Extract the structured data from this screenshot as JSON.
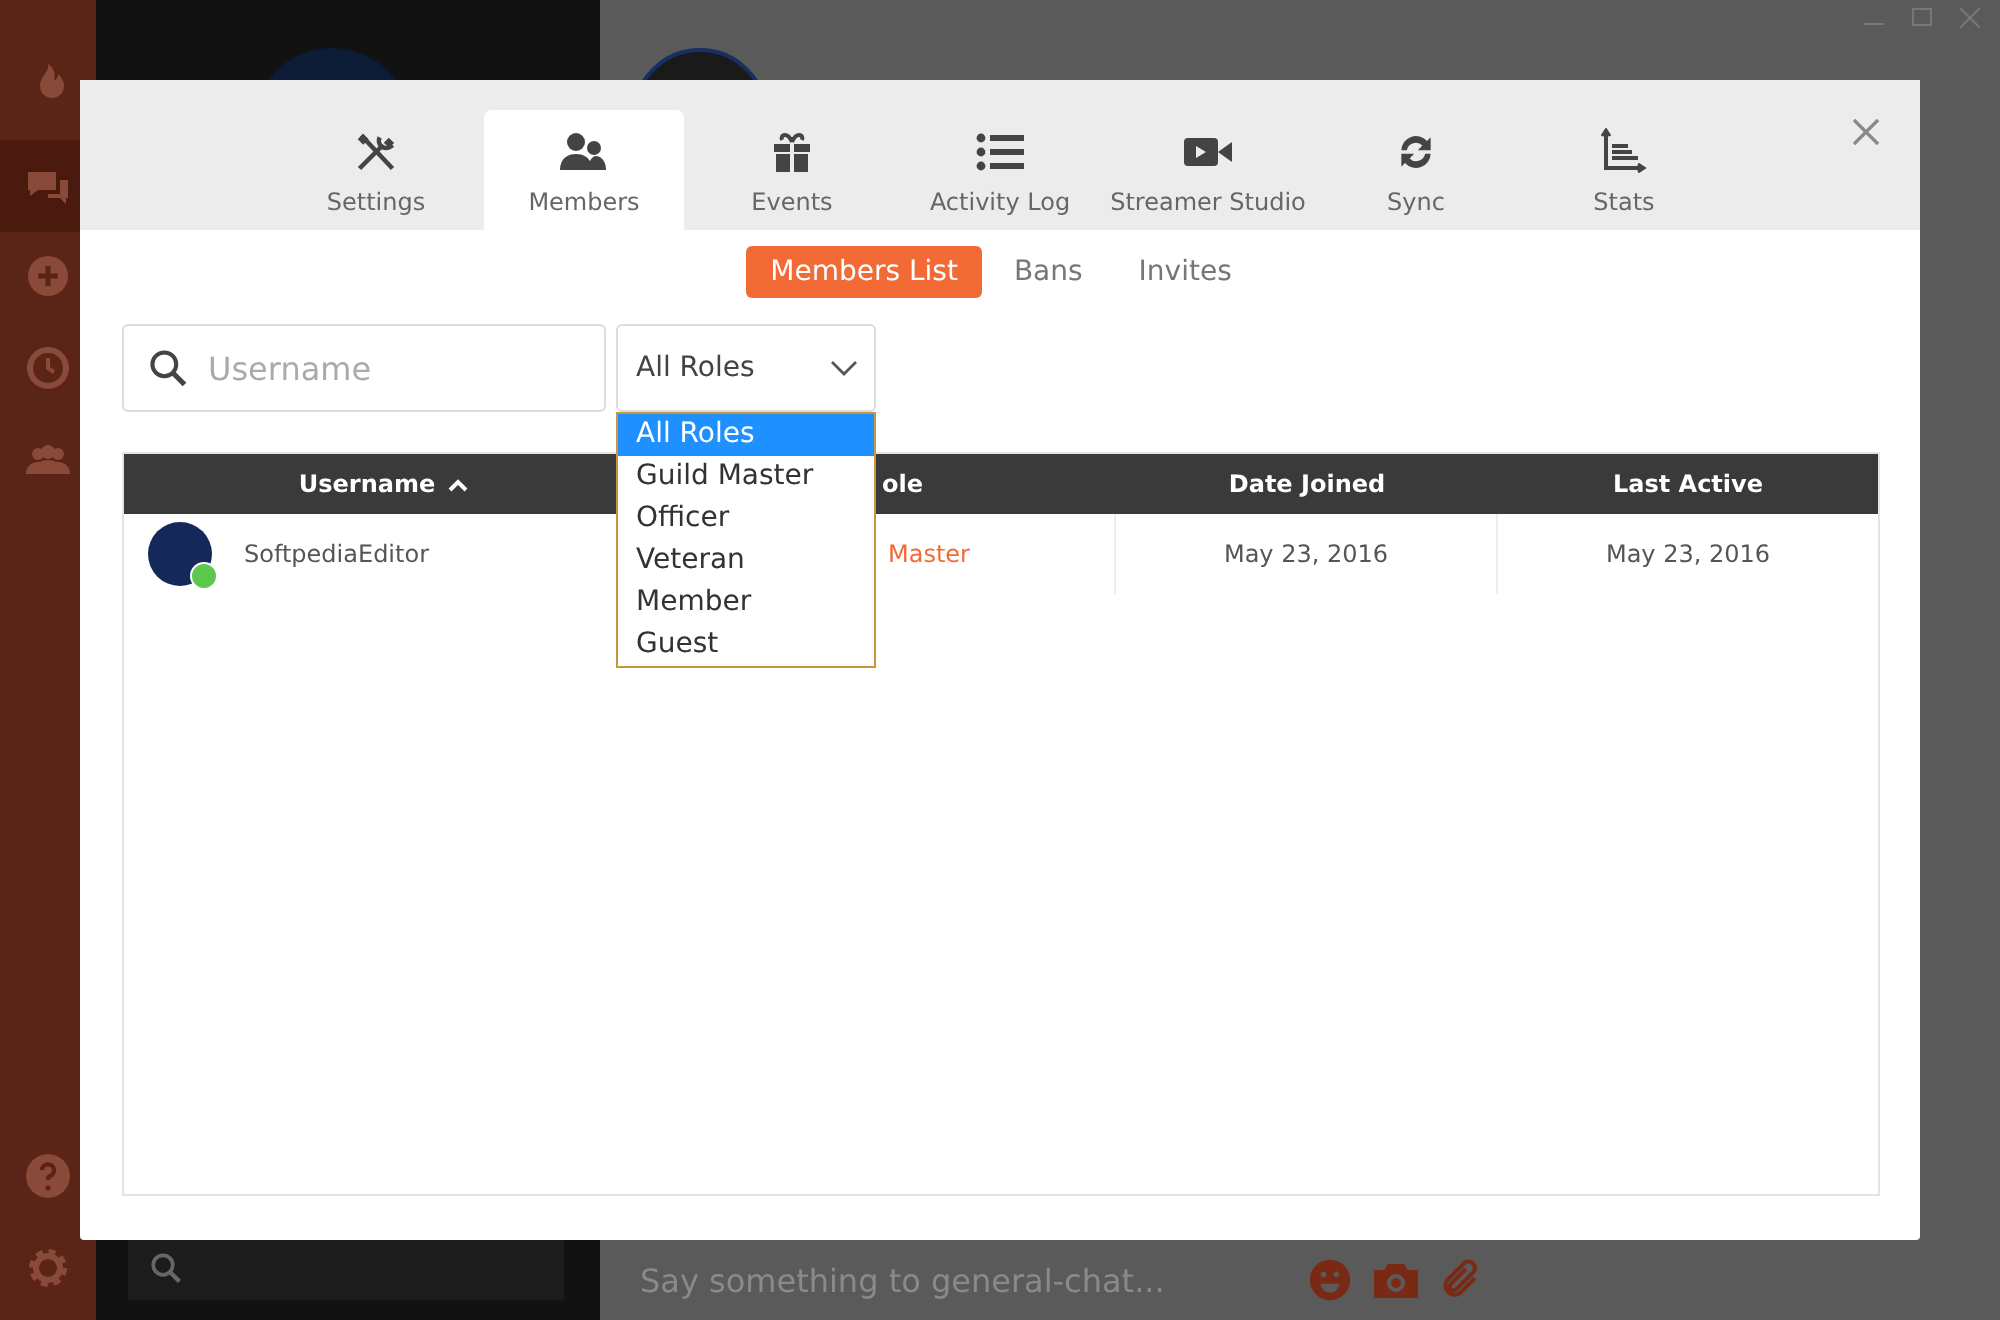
{
  "composer": {
    "placeholder": "Say something to general-chat..."
  },
  "dialog": {
    "tabs": [
      {
        "label": "Settings",
        "selected": false
      },
      {
        "label": "Members",
        "selected": true
      },
      {
        "label": "Events",
        "selected": false
      },
      {
        "label": "Activity Log",
        "selected": false
      },
      {
        "label": "Streamer Studio",
        "selected": false
      },
      {
        "label": "Sync",
        "selected": false
      },
      {
        "label": "Stats",
        "selected": false
      }
    ],
    "subtabs": [
      {
        "label": "Members List",
        "selected": true
      },
      {
        "label": "Bans",
        "selected": false
      },
      {
        "label": "Invites",
        "selected": false
      }
    ],
    "search": {
      "placeholder": "Username"
    },
    "role_filter": {
      "value": "All Roles",
      "expanded": true,
      "options": [
        {
          "label": "All Roles",
          "selected": true
        },
        {
          "label": "Guild Master",
          "selected": false
        },
        {
          "label": "Officer",
          "selected": false
        },
        {
          "label": "Veteran",
          "selected": false
        },
        {
          "label": "Member",
          "selected": false
        },
        {
          "label": "Guest",
          "selected": false
        }
      ]
    },
    "table": {
      "columns": [
        {
          "label": "Username",
          "sorted": true
        },
        {
          "label": "ole",
          "sorted": false
        },
        {
          "label": "Date Joined",
          "sorted": false
        },
        {
          "label": "Last Active",
          "sorted": false
        }
      ],
      "rows": [
        {
          "username": "SoftpediaEditor",
          "online": true,
          "role": "Master",
          "date_joined": "May 23, 2016",
          "last_active": "May 23, 2016"
        }
      ]
    }
  }
}
